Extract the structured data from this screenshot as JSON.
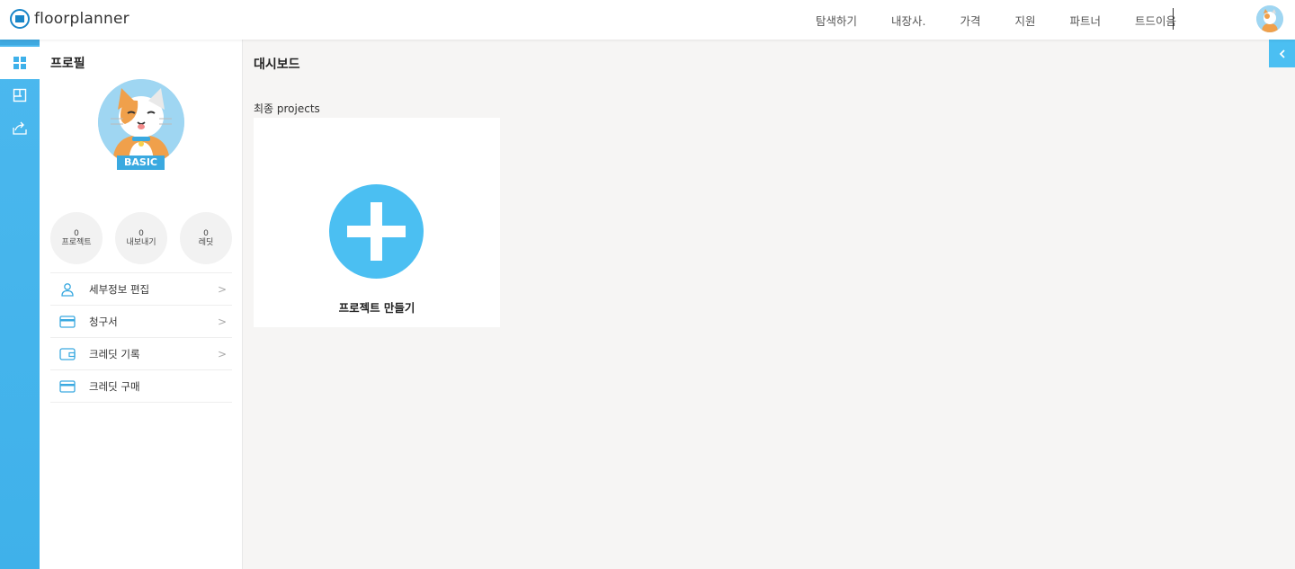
{
  "app": {
    "logo_text": "floorplanner"
  },
  "nav": {
    "items": [
      "탐색하기",
      "내장사.",
      "가격",
      "지원",
      "파트너",
      "트드이음"
    ]
  },
  "sidebar": {
    "rail_icons": [
      "dashboard-icon",
      "floorplan-icon",
      "share-icon"
    ]
  },
  "profile": {
    "title": "프로필",
    "plan": "BASIC",
    "stats": [
      {
        "value": "0",
        "label": "프로젝트"
      },
      {
        "value": "0",
        "label": "내보내기"
      },
      {
        "value": "0",
        "label": "레딧"
      }
    ],
    "menu": [
      {
        "label": "세부정보 편집",
        "icon": "user-icon",
        "chevron": true
      },
      {
        "label": "청구서",
        "icon": "card-icon",
        "chevron": true
      },
      {
        "label": "크레딧 기록",
        "icon": "wallet-icon",
        "chevron": true
      },
      {
        "label": "크레딧 구매",
        "icon": "card-icon",
        "chevron": false
      }
    ]
  },
  "main": {
    "title": "대시보드",
    "section_label": "최종 projects",
    "create_label": "프로젝트 만들기"
  },
  "colors": {
    "accent": "#4bbff2",
    "rail": "#3fb1ea",
    "badge": "#3aa9e0"
  }
}
